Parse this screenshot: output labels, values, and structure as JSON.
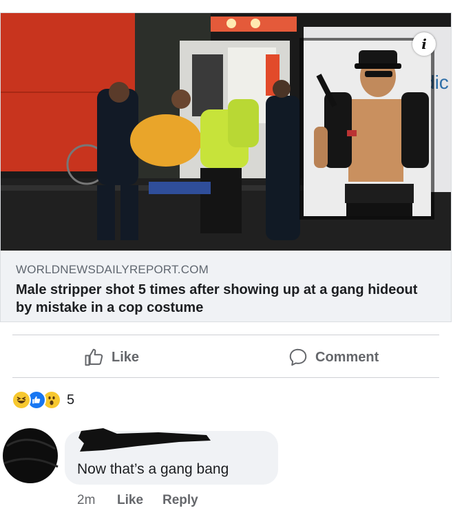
{
  "link_preview": {
    "domain": "WORLDNEWSDAILYREPORT.COM",
    "headline": "Male stripper shot 5 times after showing up at a gang hideout by mistake in a cop costume",
    "info_icon": "i"
  },
  "actions": {
    "like_label": "Like",
    "comment_label": "Comment"
  },
  "reactions": {
    "icons": [
      "haha-icon",
      "like-icon",
      "wow-icon"
    ],
    "count": "5"
  },
  "comment": {
    "text": "Now that’s a gang bang",
    "time": "2m",
    "like_label": "Like",
    "reply_label": "Reply"
  },
  "colors": {
    "facebook_blue": "#1877f2",
    "reaction_yellow": "#f7c82f",
    "muted_text": "#65676b",
    "card_bg": "#f0f2f5"
  }
}
